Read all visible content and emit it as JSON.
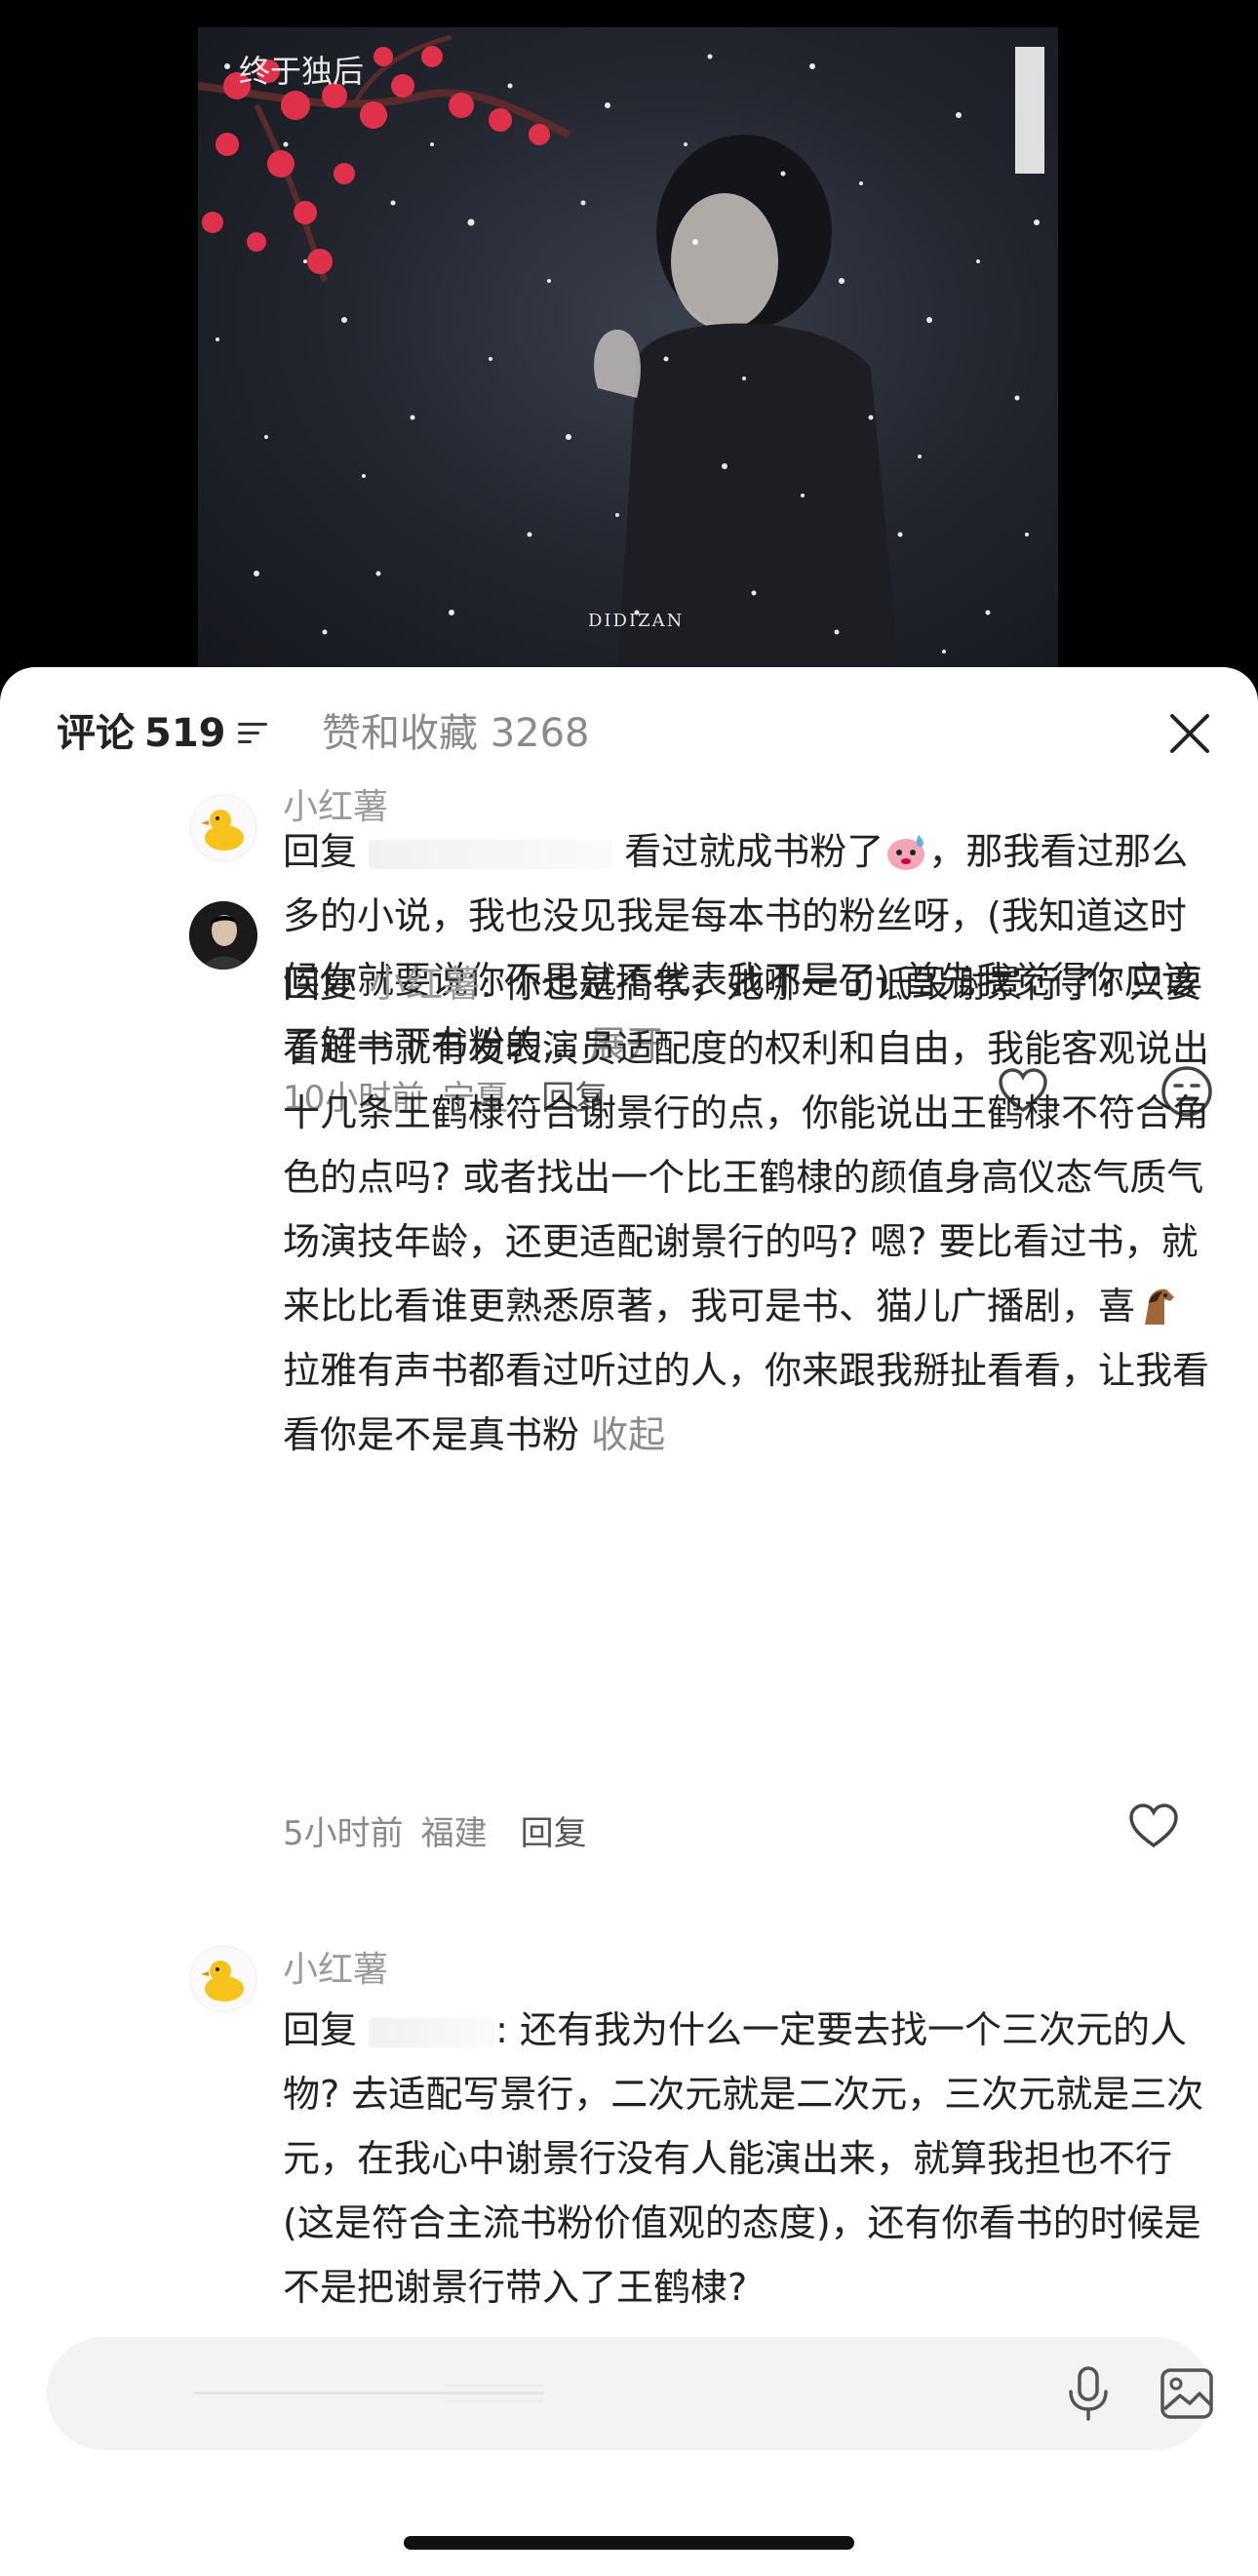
{
  "video": {
    "watermark_top": "终于独后",
    "watermark_bottom": "DIDIZAN"
  },
  "tabs": {
    "comments_label": "评论",
    "comments_count": "519",
    "likes_label": "赞和收藏 3268"
  },
  "comments": [
    {
      "username": "小红薯",
      "reply_prefix": "回复",
      "text_1": "看过就成书粉了",
      "text_2": "，那我看过那么多的小说，我也没见我是每本书的粉丝呀，(我知道这时候你就要说你不是就不代表我不是了) 首先我觉得你应该了解一下书粉的...",
      "expand": "展开",
      "time": "10小时前",
      "location": "宁夏",
      "reply": "回复"
    },
    {
      "username": "",
      "reply_prefix": "回复",
      "mention": "小红薯",
      "text": ": 你也是搞孝，她哪一句诋毁谢景行了? 只要看过书就有发表演员适配度的权利和自由，我能客观说出十几条王鹤棣符合谢景行的点，你能说出王鹤棣不符合角色的点吗? 或者找出一个比王鹤棣的颜值身高仪态气质气场演技年龄，还更适配谢景行的吗? 嗯? 要比看过书，就来比比看谁更熟悉原著，我可是书、猫儿广播剧，喜",
      "text_2": "拉雅有声书都看过听过的人，你来跟我掰扯看看，让我看看你是不是真书粉",
      "collapse": "收起",
      "time": "5小时前",
      "location": "福建",
      "reply": "回复"
    },
    {
      "username": "小红薯",
      "reply_prefix": "回复",
      "text": ": 还有我为什么一定要去找一个三次元的人物? 去适配写景行，二次元就是二次元，三次元就是三次元，在我心中谢景行没有人能演出来，就算我担也不行 (这是符合主流书粉价值观的态度)，还有你看书的时候是不是把谢景行带入了王鹤棣?"
    }
  ],
  "colors": {
    "sheet_bg": "#ffffff",
    "muted": "#8a8a8a",
    "text": "#222222",
    "input_bg": "#f3f3f3"
  },
  "icons": [
    "filter-icon",
    "close-icon",
    "heart-icon",
    "meh-icon",
    "duck-avatar-icon",
    "mic-icon",
    "image-icon",
    "horse-emoji-icon",
    "sweat-emoji-icon"
  ]
}
